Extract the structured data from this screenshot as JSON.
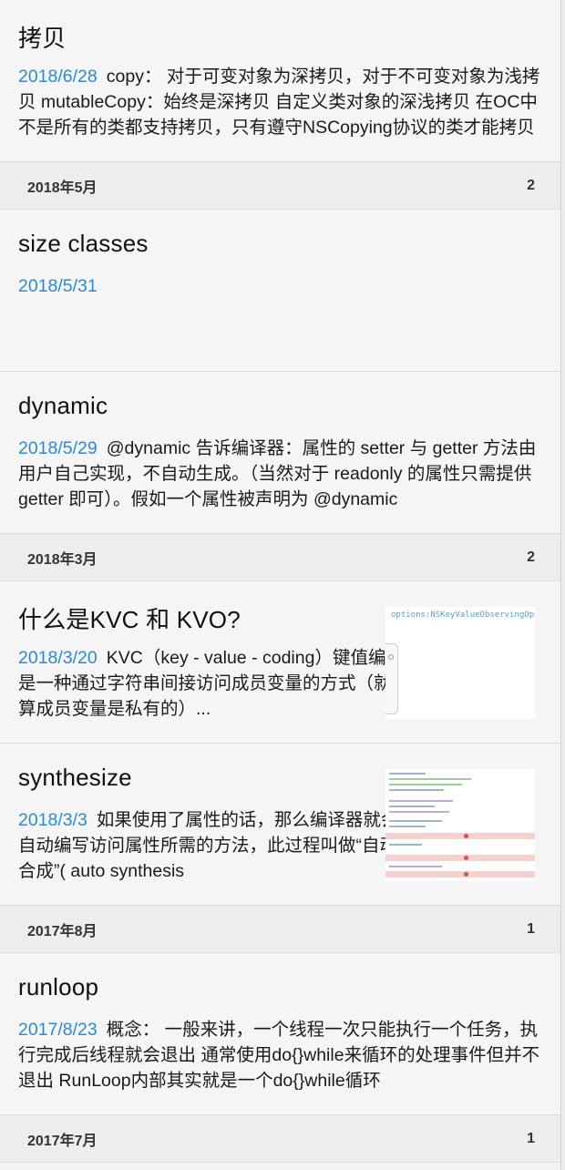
{
  "posts_top": {
    "title": "拷贝",
    "date": "2018/6/28",
    "excerpt": "copy： 对于可变对象为深拷贝，对于不可变对象为浅拷贝 mutableCopy：始终是深拷贝 自定义类对象的深浅拷贝 在OC中不是所有的类都支持拷贝，只有遵守NSCopying协议的类才能拷贝"
  },
  "groups": [
    {
      "month": "2018年5月",
      "count": "2",
      "posts": [
        {
          "title": "size classes",
          "date": "2018/5/31",
          "excerpt": ""
        },
        {
          "title": "dynamic",
          "date": "2018/5/29",
          "excerpt": "@dynamic 告诉编译器：属性的 setter 与 getter 方法由用户自己实现，不自动生成。（当然对于 readonly 的属性只需提供 getter 即可）。假如一个属性被声明为 @dynamic"
        }
      ]
    },
    {
      "month": "2018年3月",
      "count": "2",
      "posts": [
        {
          "title": "什么是KVC 和 KVO?",
          "date": "2018/3/20",
          "excerpt": "KVC（key - value - coding）键值编码是一种通过字符串间接访问成员变量的方式（就算成员变量是私有的）...",
          "thumb_text": "options:NSKeyValueObservingOptionNew"
        },
        {
          "title": "synthesize",
          "date": "2018/3/3",
          "excerpt": "如果使用了属性的话，那么编译器就会自动编写访问属性所需的方法，此过程叫做“自动合成”( auto synthesis"
        }
      ]
    },
    {
      "month": "2017年8月",
      "count": "1",
      "posts": [
        {
          "title": "runloop",
          "date": "2017/8/23",
          "excerpt": "概念： 一般来讲，一个线程一次只能执行一个任务，执行完成后线程就会退出 通常使用do{}while来循环的处理事件但并不退出 RunLoop内部其实就是一个do{}while循环"
        }
      ]
    },
    {
      "month": "2017年7月",
      "count": "1",
      "posts": []
    }
  ],
  "colors": {
    "date": "#2a8ad6",
    "background": "#f5f5f5",
    "group_header": "#ededed"
  }
}
